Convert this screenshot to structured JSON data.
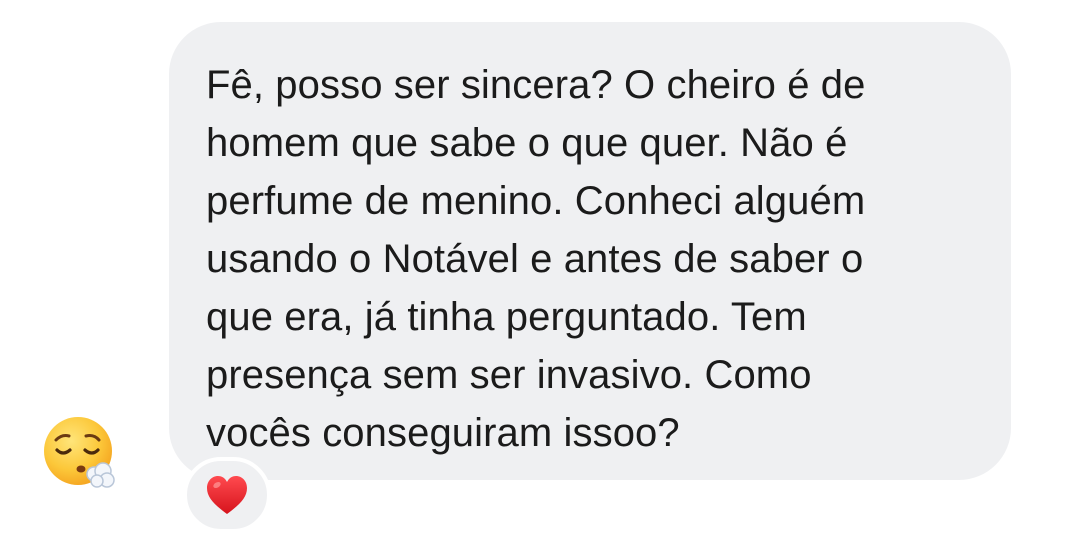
{
  "message": {
    "text": "Fê, posso ser sincera? O cheiro é de\nhomem que sabe o que quer. Não é\nperfume de menino. Conheci alguém\nusando o Notável e antes de saber o\nque era, já tinha perguntado. Tem\npresença sem ser invasivo. Como\nvocês conseguiram issoo?",
    "bubble_color": "#eff0f2",
    "text_color": "#1b1b1b"
  },
  "sender": {
    "avatar_icon": "face-exhaling-emoji-icon"
  },
  "reaction": {
    "icon": "red-heart-icon",
    "color": "#e0242d"
  }
}
